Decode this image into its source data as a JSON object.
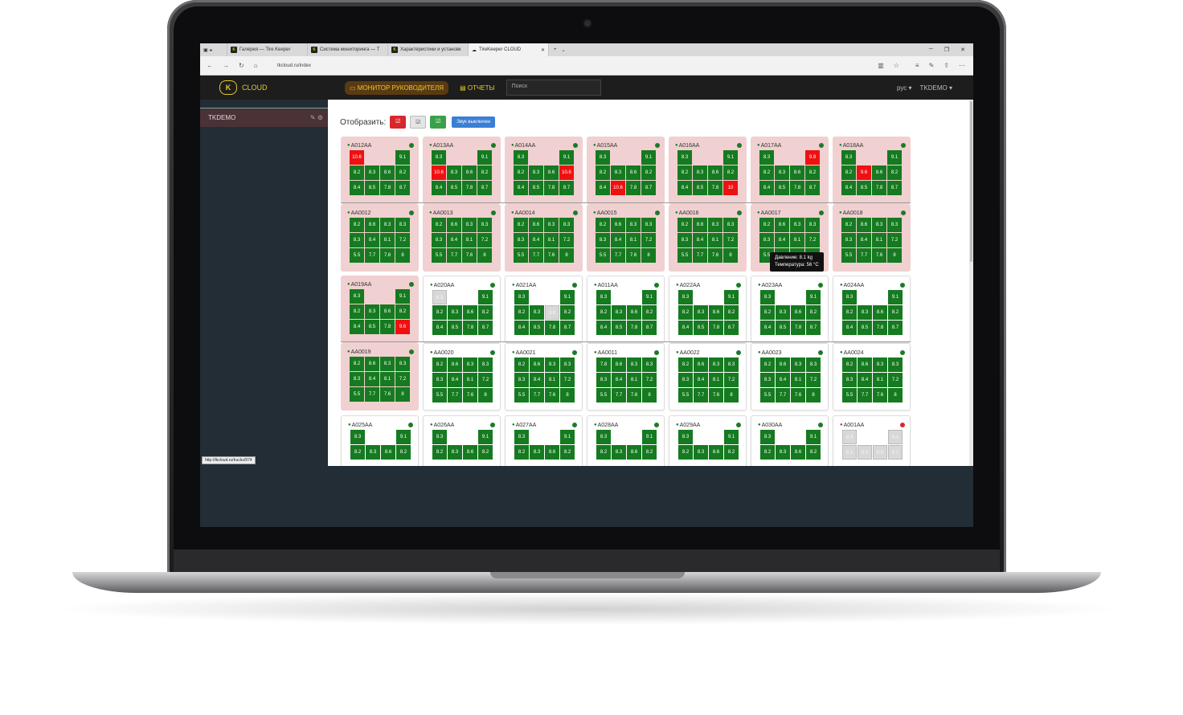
{
  "browser": {
    "tabs": [
      {
        "label": "Галерея — Tire Keeper"
      },
      {
        "label": "Система мониторинга — T"
      },
      {
        "label": "Характеристики и установк"
      },
      {
        "label": "TireKeeper CLOUD"
      }
    ],
    "url": "tkcloud.ru/index"
  },
  "nav": {
    "logo_text": "CLOUD",
    "monitor": "МОНИТОР РУКОВОДИТЕЛЯ",
    "reports": "ОТЧЕТЫ",
    "search_placeholder": "Поиск",
    "lang": "рус",
    "user": "TKDEMO"
  },
  "sidebar": {
    "item": "TKDEMO"
  },
  "status_url": "http://tkcloud.ru/trucks/974",
  "filter": {
    "label": "Отобразить:",
    "sound": "Звук выключен"
  },
  "tooltip": {
    "line1": "Давление: 8.1 kg",
    "line2": "Температура: 56 °C"
  },
  "vehicles": [
    {
      "name": "A012AA",
      "status": "alert",
      "rows": [
        [
          "10.6",
          "",
          "",
          "9.1"
        ],
        [
          "8.2",
          "8.3",
          "8.6",
          "8.2"
        ],
        [
          "8.4",
          "8.5",
          "7.8",
          "8.7"
        ]
      ],
      "red": [
        [
          0,
          0
        ]
      ]
    },
    {
      "name": "A013AA",
      "status": "alert",
      "rows": [
        [
          "8.3",
          "",
          "",
          "9.1"
        ],
        [
          "10.6",
          "8.3",
          "8.6",
          "8.2"
        ],
        [
          "8.4",
          "8.5",
          "7.8",
          "8.7"
        ]
      ],
      "red": [
        [
          1,
          0
        ]
      ]
    },
    {
      "name": "A014AA",
      "status": "alert",
      "rows": [
        [
          "8.3",
          "",
          "",
          "9.1"
        ],
        [
          "8.2",
          "8.3",
          "8.6",
          "10.6"
        ],
        [
          "8.4",
          "8.5",
          "7.8",
          "8.7"
        ]
      ],
      "red": [
        [
          1,
          3
        ]
      ]
    },
    {
      "name": "A015AA",
      "status": "alert",
      "rows": [
        [
          "8.3",
          "",
          "",
          "9.1"
        ],
        [
          "8.2",
          "8.3",
          "8.6",
          "8.2"
        ],
        [
          "8.4",
          "10.6",
          "7.8",
          "8.7"
        ]
      ],
      "red": [
        [
          2,
          1
        ]
      ]
    },
    {
      "name": "A016AA",
      "status": "alert",
      "rows": [
        [
          "8.3",
          "",
          "",
          "9.1"
        ],
        [
          "8.2",
          "8.3",
          "8.6",
          "8.2"
        ],
        [
          "8.4",
          "8.5",
          "7.8",
          "10"
        ]
      ],
      "red": [
        [
          2,
          3
        ]
      ]
    },
    {
      "name": "A017AA",
      "status": "alert",
      "rows": [
        [
          "8.3",
          "",
          "",
          "9.8"
        ],
        [
          "8.2",
          "8.3",
          "8.6",
          "8.2"
        ],
        [
          "8.4",
          "8.5",
          "7.8",
          "8.7"
        ]
      ],
      "red": [
        [
          0,
          3
        ]
      ]
    },
    {
      "name": "A018AA",
      "status": "alert",
      "rows": [
        [
          "8.3",
          "",
          "",
          "9.1"
        ],
        [
          "8.2",
          "9.6",
          "8.6",
          "8.2"
        ],
        [
          "8.4",
          "8.5",
          "7.8",
          "8.7"
        ]
      ],
      "red": [
        [
          1,
          1
        ]
      ]
    },
    {
      "name": "AA0012",
      "status": "alert",
      "rows": [
        [
          "8.2",
          "8.6",
          "8.3",
          "8.3"
        ],
        [
          "8.3",
          "8.4",
          "8.1",
          "7.2"
        ],
        [
          "5.5",
          "7.7",
          "7.6",
          "8"
        ]
      ]
    },
    {
      "name": "AA0013",
      "status": "alert",
      "rows": [
        [
          "8.2",
          "8.6",
          "8.3",
          "8.3"
        ],
        [
          "8.3",
          "8.4",
          "8.1",
          "7.2"
        ],
        [
          "5.5",
          "7.7",
          "7.6",
          "8"
        ]
      ]
    },
    {
      "name": "AA0014",
      "status": "alert",
      "rows": [
        [
          "8.2",
          "8.6",
          "8.3",
          "8.3"
        ],
        [
          "8.3",
          "8.4",
          "8.1",
          "7.2"
        ],
        [
          "5.5",
          "7.7",
          "7.6",
          "8"
        ]
      ]
    },
    {
      "name": "AA0015",
      "status": "alert",
      "rows": [
        [
          "8.2",
          "8.6",
          "8.3",
          "8.3"
        ],
        [
          "8.3",
          "8.4",
          "8.1",
          "7.2"
        ],
        [
          "5.5",
          "7.7",
          "7.6",
          "8"
        ]
      ]
    },
    {
      "name": "AA0016",
      "status": "alert",
      "rows": [
        [
          "8.2",
          "8.6",
          "8.3",
          "8.3"
        ],
        [
          "8.3",
          "8.4",
          "8.1",
          "7.2"
        ],
        [
          "5.5",
          "7.7",
          "7.6",
          "8"
        ]
      ]
    },
    {
      "name": "AA0017",
      "status": "alert",
      "rows": [
        [
          "8.2",
          "8.6",
          "8.3",
          "8.3"
        ],
        [
          "8.3",
          "8.4",
          "8.1",
          "7.2"
        ],
        [
          "5.5",
          "7.7",
          "7.6",
          "8"
        ]
      ]
    },
    {
      "name": "AA0018",
      "status": "alert",
      "rows": [
        [
          "8.2",
          "8.6",
          "8.3",
          "8.3"
        ],
        [
          "8.3",
          "8.4",
          "8.1",
          "7.2"
        ],
        [
          "5.5",
          "7.7",
          "7.6",
          "8"
        ]
      ]
    },
    {
      "name": "A019AA",
      "status": "alert",
      "rows": [
        [
          "8.3",
          "",
          "",
          "9.1"
        ],
        [
          "8.2",
          "8.3",
          "8.6",
          "8.2"
        ],
        [
          "8.4",
          "8.5",
          "7.8",
          "9.6"
        ]
      ],
      "red": [
        [
          2,
          3
        ]
      ]
    },
    {
      "name": "A020AA",
      "status": "ok",
      "rows": [
        [
          "8.3",
          "",
          "",
          "9.1"
        ],
        [
          "8.2",
          "8.3",
          "8.6",
          "8.2"
        ],
        [
          "8.4",
          "8.5",
          "7.8",
          "8.7"
        ]
      ],
      "nodata": [
        [
          0,
          0
        ]
      ]
    },
    {
      "name": "A021AA",
      "status": "ok",
      "rows": [
        [
          "8.3",
          "",
          "",
          "9.1"
        ],
        [
          "8.2",
          "8.3",
          "8.6",
          "8.2"
        ],
        [
          "8.4",
          "8.5",
          "7.8",
          "8.7"
        ]
      ],
      "nodata": [
        [
          1,
          2
        ]
      ]
    },
    {
      "name": "A011AA",
      "status": "ok",
      "rows": [
        [
          "8.3",
          "",
          "",
          "9.1"
        ],
        [
          "8.2",
          "8.3",
          "8.6",
          "8.2"
        ],
        [
          "8.4",
          "8.5",
          "7.8",
          "8.7"
        ]
      ]
    },
    {
      "name": "A022AA",
      "status": "ok",
      "rows": [
        [
          "8.3",
          "",
          "",
          "9.1"
        ],
        [
          "8.2",
          "8.3",
          "8.6",
          "8.2"
        ],
        [
          "8.4",
          "8.5",
          "7.8",
          "8.7"
        ]
      ]
    },
    {
      "name": "A023AA",
      "status": "ok",
      "rows": [
        [
          "8.3",
          "",
          "",
          "9.1"
        ],
        [
          "8.2",
          "8.3",
          "8.6",
          "8.2"
        ],
        [
          "8.4",
          "8.5",
          "7.8",
          "8.7"
        ]
      ]
    },
    {
      "name": "A024AA",
      "status": "ok",
      "rows": [
        [
          "8.3",
          "",
          "",
          "9.1"
        ],
        [
          "8.2",
          "8.3",
          "8.6",
          "8.2"
        ],
        [
          "8.4",
          "8.5",
          "7.8",
          "8.7"
        ]
      ]
    },
    {
      "name": "AA0019",
      "status": "alert",
      "rows": [
        [
          "8.2",
          "8.6",
          "8.3",
          "8.3"
        ],
        [
          "8.3",
          "8.4",
          "8.1",
          "7.2"
        ],
        [
          "5.5",
          "7.7",
          "7.6",
          "8"
        ]
      ]
    },
    {
      "name": "AA0020",
      "status": "ok",
      "rows": [
        [
          "8.2",
          "8.6",
          "8.3",
          "8.3"
        ],
        [
          "8.3",
          "8.4",
          "8.1",
          "7.2"
        ],
        [
          "5.5",
          "7.7",
          "7.6",
          "8"
        ]
      ]
    },
    {
      "name": "AA0021",
      "status": "ok",
      "rows": [
        [
          "8.2",
          "8.6",
          "8.3",
          "8.3"
        ],
        [
          "8.3",
          "8.4",
          "8.1",
          "7.2"
        ],
        [
          "5.5",
          "7.7",
          "7.6",
          "8"
        ]
      ]
    },
    {
      "name": "AA0011",
      "status": "ok",
      "rows": [
        [
          "7.8",
          "8.6",
          "8.3",
          "8.3"
        ],
        [
          "8.3",
          "8.4",
          "8.1",
          "7.2"
        ],
        [
          "5.5",
          "7.7",
          "7.6",
          "8"
        ]
      ]
    },
    {
      "name": "AA0022",
      "status": "ok",
      "rows": [
        [
          "8.2",
          "8.6",
          "8.3",
          "8.3"
        ],
        [
          "8.3",
          "8.4",
          "8.1",
          "7.2"
        ],
        [
          "5.5",
          "7.7",
          "7.6",
          "8"
        ]
      ]
    },
    {
      "name": "AA0023",
      "status": "ok",
      "rows": [
        [
          "8.2",
          "8.6",
          "8.3",
          "8.3"
        ],
        [
          "8.3",
          "8.4",
          "8.1",
          "7.2"
        ],
        [
          "5.5",
          "7.7",
          "7.6",
          "8"
        ]
      ]
    },
    {
      "name": "AA0024",
      "status": "ok",
      "rows": [
        [
          "8.2",
          "8.6",
          "8.3",
          "8.3"
        ],
        [
          "8.3",
          "8.4",
          "8.1",
          "7.2"
        ],
        [
          "5.5",
          "7.7",
          "7.6",
          "8"
        ]
      ]
    },
    {
      "name": "A025AA",
      "status": "ok",
      "rows": [
        [
          "8.3",
          "",
          "",
          "9.1"
        ],
        [
          "8.2",
          "8.3",
          "8.6",
          "8.2"
        ]
      ]
    },
    {
      "name": "A026AA",
      "status": "ok",
      "rows": [
        [
          "8.3",
          "",
          "",
          "9.1"
        ],
        [
          "8.2",
          "8.3",
          "8.6",
          "8.2"
        ]
      ]
    },
    {
      "name": "A027AA",
      "status": "ok",
      "rows": [
        [
          "8.3",
          "",
          "",
          "9.1"
        ],
        [
          "8.2",
          "8.3",
          "8.6",
          "8.2"
        ]
      ]
    },
    {
      "name": "A028AA",
      "status": "ok",
      "rows": [
        [
          "8.3",
          "",
          "",
          "9.1"
        ],
        [
          "8.2",
          "8.3",
          "8.6",
          "8.2"
        ]
      ]
    },
    {
      "name": "A029AA",
      "status": "ok",
      "rows": [
        [
          "8.3",
          "",
          "",
          "9.1"
        ],
        [
          "8.2",
          "8.3",
          "8.6",
          "8.2"
        ]
      ]
    },
    {
      "name": "A030AA",
      "status": "ok",
      "rows": [
        [
          "8.3",
          "",
          "",
          "9.1"
        ],
        [
          "8.2",
          "8.3",
          "8.6",
          "8.2"
        ]
      ]
    },
    {
      "name": "A001AA",
      "status": "offline",
      "rows": [
        [
          "8.3",
          "",
          "",
          "9.1"
        ],
        [
          "8.2",
          "8.3",
          "8.6",
          "8.2"
        ]
      ],
      "allnodata": true
    }
  ],
  "colors": {
    "green": "#157a20",
    "red": "#ee1111",
    "alert_bg": "#f0d0d0",
    "accent": "#e3ca2c"
  }
}
